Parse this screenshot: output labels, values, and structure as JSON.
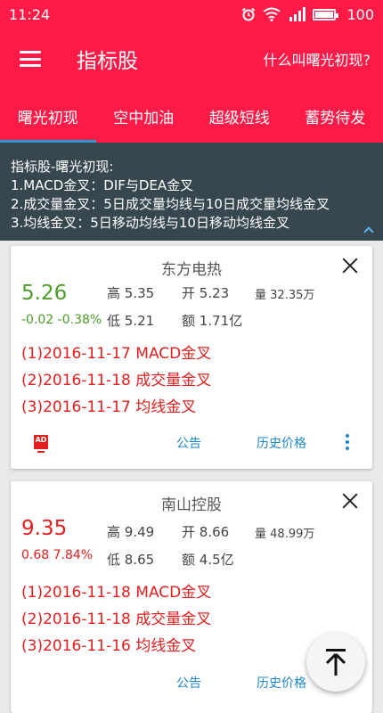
{
  "status_bar": {
    "time": "11:24",
    "battery": "100"
  },
  "app_bar": {
    "title": "指标股",
    "help_link": "什么叫曙光初现?"
  },
  "tabs": [
    {
      "label": "曙光初现",
      "active": true
    },
    {
      "label": "空中加油",
      "active": false
    },
    {
      "label": "超级短线",
      "active": false
    },
    {
      "label": "蓄势待发",
      "active": false
    }
  ],
  "info_panel": {
    "title": "指标股-曙光初现:",
    "lines": [
      "1.MACD金叉：DIF与DEA金叉",
      "2.成交量金叉：5日成交量均线与10日成交量均线金叉",
      "3.均线金叉：5日移动均线与10日移动均线金叉"
    ]
  },
  "stocks": [
    {
      "name": "东方电热",
      "price": "5.26",
      "change": "-0.02 -0.38%",
      "high_label": "高",
      "high": "5.35",
      "open_label": "开",
      "open": "5.23",
      "volume_label": "量",
      "volume": "32.35万",
      "low_label": "低",
      "low": "5.21",
      "amount_label": "额",
      "amount": "1.71亿",
      "signals": [
        "(1)2016-11-17 MACD金叉",
        "(2)2016-11-18 成交量金叉",
        "(3)2016-11-17 均线金叉"
      ],
      "announce_label": "公告",
      "history_label": "历史价格"
    },
    {
      "name": "南山控股",
      "price": "9.35",
      "change": "0.68 7.84%",
      "high_label": "高",
      "high": "9.49",
      "open_label": "开",
      "open": "8.66",
      "volume_label": "量",
      "volume": "48.99万",
      "low_label": "低",
      "low": "8.65",
      "amount_label": "额",
      "amount": "4.5亿",
      "signals": [
        "(1)2016-11-18 MACD金叉",
        "(2)2016-11-18 成交量金叉",
        "(3)2016-11-16 均线金叉"
      ],
      "announce_label": "公告",
      "history_label": "历史价格"
    }
  ],
  "ad_badge": "AD",
  "colors": {
    "accent": "#ff1a47",
    "panel": "#37474f",
    "up": "#e02020",
    "down": "#4d9c2a",
    "link": "#1e88c7"
  }
}
